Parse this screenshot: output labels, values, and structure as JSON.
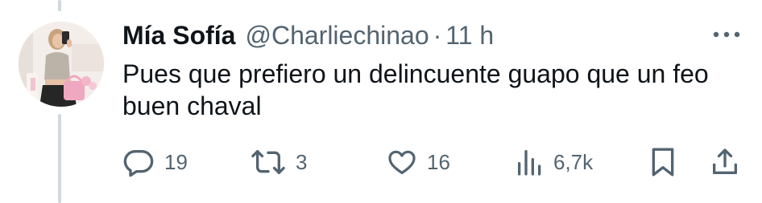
{
  "tweet": {
    "author": {
      "display_name": "Mía Sofía",
      "handle": "@Charliechinao"
    },
    "separator": "·",
    "timestamp": "11 h",
    "text": "Pues que prefiero un delincuente guapo que un feo buen chaval",
    "actions": {
      "replies": "19",
      "retweets": "3",
      "likes": "16",
      "views": "6,7k"
    }
  },
  "icons": {
    "more": "more-horizontal-icon",
    "reply": "reply-icon",
    "retweet": "retweet-icon",
    "like": "heart-icon",
    "views": "views-bar-chart-icon",
    "bookmark": "bookmark-icon",
    "share": "share-icon"
  },
  "colors": {
    "text_primary": "#0f1419",
    "text_secondary": "#536471",
    "thread_line": "#cfd9de"
  }
}
